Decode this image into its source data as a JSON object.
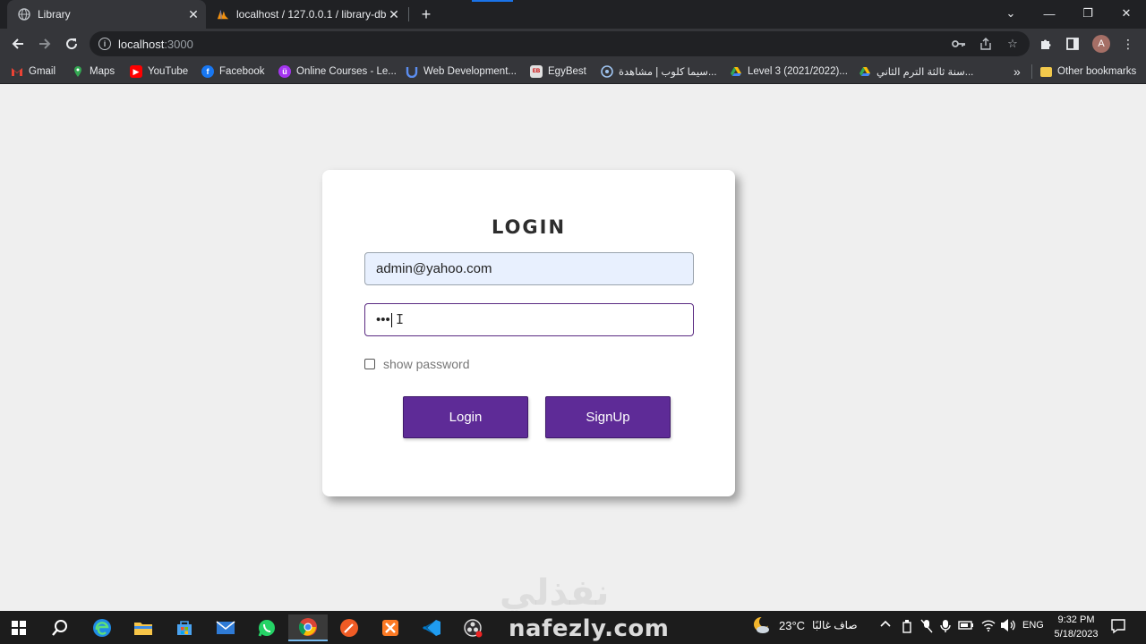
{
  "browser": {
    "tabs": [
      {
        "title": "Library",
        "icon": "globe-icon",
        "active": true
      },
      {
        "title": "localhost / 127.0.0.1 / library-db",
        "icon": "phpmyadmin-icon",
        "active": false
      }
    ],
    "window_controls": {
      "dropdown": "⌄",
      "minimize": "—",
      "restore": "❐",
      "close": "✕"
    },
    "address": {
      "host": "localhost",
      "port": ":3000"
    },
    "bookmarks": [
      {
        "label": "Gmail",
        "icon": "gmail-icon",
        "color": "#ea4335"
      },
      {
        "label": "Maps",
        "icon": "maps-icon",
        "color": "#34a853"
      },
      {
        "label": "YouTube",
        "icon": "youtube-icon",
        "color": "#ff0000"
      },
      {
        "label": "Facebook",
        "icon": "facebook-icon",
        "color": "#1877f2"
      },
      {
        "label": "Online Courses - Le...",
        "icon": "udemy-icon",
        "color": "#a435f0"
      },
      {
        "label": "Web Development...",
        "icon": "webdev-icon",
        "color": "#5b8def"
      },
      {
        "label": "EgyBest",
        "icon": "egybest-icon",
        "color": "#e0e0e0"
      },
      {
        "label": "سيما كلوب | مشاهدة...",
        "icon": "cimaclub-icon",
        "color": "#4a90d9"
      },
      {
        "label": "Level 3 (2021/2022)...",
        "icon": "drive-icon",
        "color": "#fbbc04"
      },
      {
        "label": "سنة ثالثة الترم الثاني...",
        "icon": "drive-icon",
        "color": "#fbbc04"
      }
    ],
    "bookmarks_overflow": "»",
    "other_bookmarks": "Other bookmarks",
    "avatar_letter": "A"
  },
  "login": {
    "title": "LOGIN",
    "email_value": "admin@yahoo.com",
    "password_mask": "•••",
    "show_password_label": "show password",
    "login_button": "Login",
    "signup_button": "SignUp",
    "accent_color": "#5e2b97"
  },
  "watermark": {
    "arabic": "نفذلي",
    "latin": "nafezly.com"
  },
  "taskbar": {
    "weather_temp": "23°C",
    "weather_text": "صاف غالبًا",
    "language": "ENG",
    "time": "9:32 PM",
    "date": "5/18/2023"
  }
}
